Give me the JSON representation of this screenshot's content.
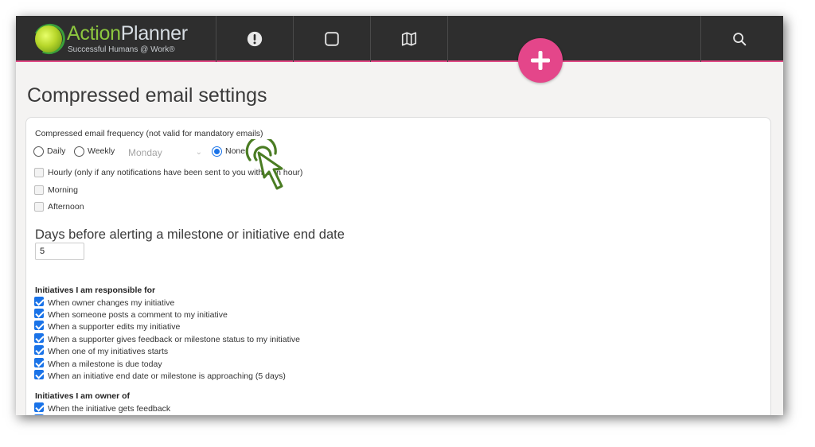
{
  "header": {
    "logo_part1": "Action",
    "logo_part2": "Planner",
    "logo_tagline": "Successful Humans @ Work®",
    "nav_icons": [
      "alert-icon",
      "square-icon",
      "map-icon",
      "search-icon"
    ],
    "add_icon": "plus-icon",
    "accent_color": "#e4468a"
  },
  "page": {
    "title": "Compressed email settings"
  },
  "frequency": {
    "label": "Compressed email frequency (not valid for mandatory emails)",
    "options": [
      "Daily",
      "Weekly",
      "None"
    ],
    "selected": "None",
    "weekday_value": "Monday",
    "time_options": [
      {
        "label": "Hourly (only if any notifications have been sent to you within an hour)",
        "checked": false
      },
      {
        "label": "Morning",
        "checked": false
      },
      {
        "label": "Afternoon",
        "checked": false
      }
    ]
  },
  "alert_days": {
    "label": "Days before alerting a milestone or initiative end date",
    "value": "5"
  },
  "responsible": {
    "heading": "Initiatives I am responsible for",
    "items": [
      {
        "label": "When owner changes my initiative",
        "checked": true
      },
      {
        "label": "When someone posts a comment to my initiative",
        "checked": true
      },
      {
        "label": "When a supporter edits my initiative",
        "checked": true
      },
      {
        "label": "When a supporter gives feedback or milestone status to my initiative",
        "checked": true
      },
      {
        "label": "When one of my initiatives starts",
        "checked": true
      },
      {
        "label": "When a milestone is due today",
        "checked": true
      },
      {
        "label": "When an initiative end date or milestone is approaching (5 days)",
        "checked": true
      }
    ]
  },
  "owner": {
    "heading": "Initiatives I am owner of",
    "items": [
      {
        "label": "When the initiative gets feedback",
        "checked": true
      }
    ]
  }
}
